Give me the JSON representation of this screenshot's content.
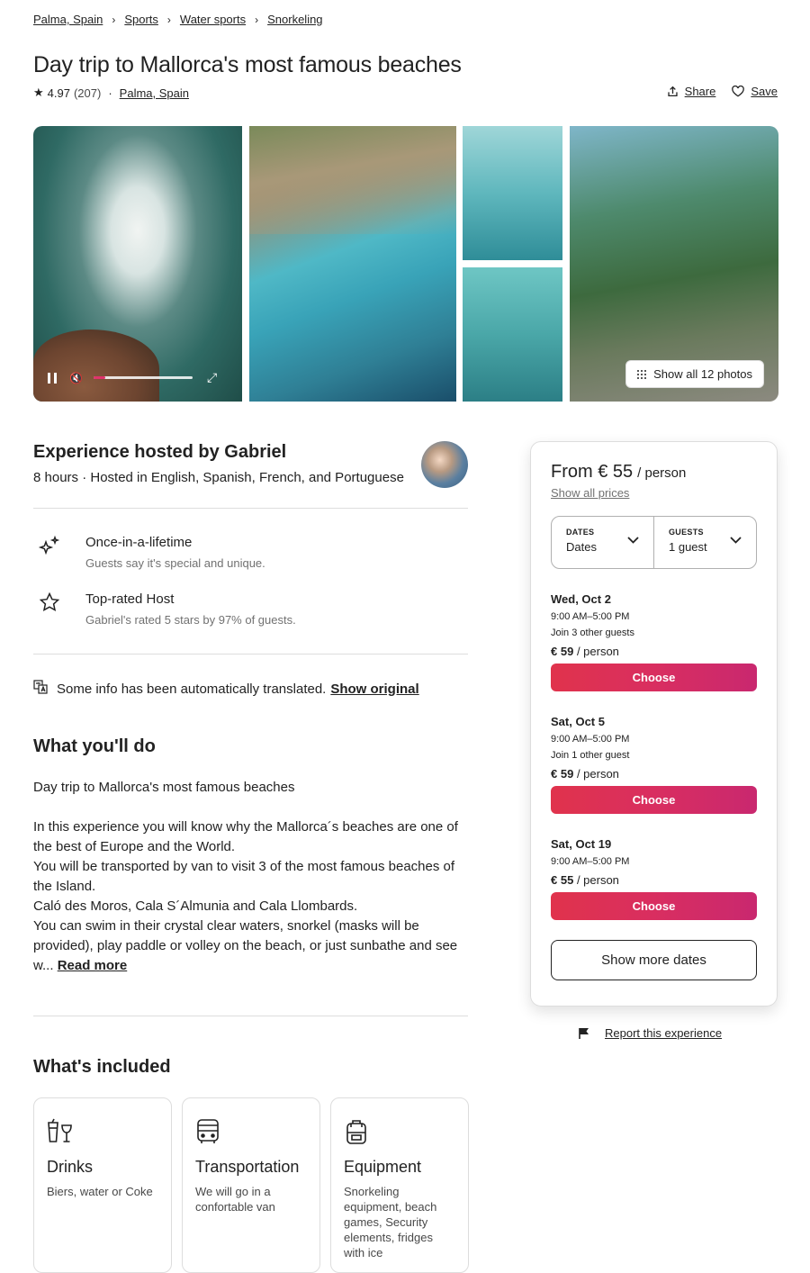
{
  "breadcrumb": [
    {
      "label": "Palma, Spain"
    },
    {
      "label": "Sports"
    },
    {
      "label": "Water sports"
    },
    {
      "label": "Snorkeling"
    }
  ],
  "header": {
    "title": "Day trip to Mallorca's most famous beaches",
    "rating": "4.97",
    "reviews": "(207)",
    "location": "Palma, Spain",
    "share_label": "Share",
    "save_label": "Save"
  },
  "gallery": {
    "show_all_label": "Show all 12 photos",
    "video_progress": 0.12
  },
  "host": {
    "title": "Experience hosted by Gabriel",
    "subtitle": "8 hours · Hosted in English, Spanish, French, and Portuguese"
  },
  "features": [
    {
      "title": "Once-in-a-lifetime",
      "subtitle": "Guests say it's special and unique.",
      "icon": "sparkles-icon"
    },
    {
      "title": "Top-rated Host",
      "subtitle": "Gabriel's rated 5 stars by 97% of guests.",
      "icon": "star-icon"
    }
  ],
  "translation": {
    "text": "Some info has been automatically translated.",
    "link": "Show original"
  },
  "what_youll_do": {
    "title": "What you'll do",
    "paragraphs": [
      "Day trip to Mallorca's most famous beaches",
      "In this experience you will know why the Mallorca´s beaches are one of the best of Europe and the World.",
      "You will be transported by van to visit 3 of the most famous beaches of the Island.",
      "Caló des Moros, Cala S´Almunia and Cala Llombards.",
      "You can swim in their crystal clear waters, snorkel (masks will be provided), play paddle or volley on the beach, or just sunbathe and see w..."
    ],
    "read_more": "Read more"
  },
  "included": {
    "title": "What's included",
    "items": [
      {
        "title": "Drinks",
        "subtitle": "Biers, water or Coke",
        "icon": "drinks-icon"
      },
      {
        "title": "Transportation",
        "subtitle": "We will go in a confortable van",
        "icon": "bus-icon"
      },
      {
        "title": "Equipment",
        "subtitle": "Snorkeling equipment, beach games, Security elements, fridges with ice",
        "icon": "backpack-icon"
      }
    ]
  },
  "booking": {
    "from": "From € 55",
    "per_person": "/ person",
    "show_all_prices": "Show all prices",
    "dates_label": "DATES",
    "dates_value": "Dates",
    "guests_label": "GUESTS",
    "guests_value": "1 guest",
    "choose_label": "Choose",
    "slots": [
      {
        "date": "Wed, Oct 2",
        "time": "9:00 AM–5:00 PM",
        "join": "Join 3 other guests",
        "price": "€ 59",
        "per": "/ person"
      },
      {
        "date": "Sat, Oct 5",
        "time": "9:00 AM–5:00 PM",
        "join": "Join 1 other guest",
        "price": "€ 59",
        "per": "/ person"
      },
      {
        "date": "Sat, Oct 19",
        "time": "9:00 AM–5:00 PM",
        "join": "",
        "price": "€ 55",
        "per": "/ person"
      }
    ],
    "show_more_dates": "Show more dates"
  },
  "report": {
    "label": "Report this experience"
  },
  "colors": {
    "accent": "#e0334c",
    "accent_end": "#c9286f"
  }
}
